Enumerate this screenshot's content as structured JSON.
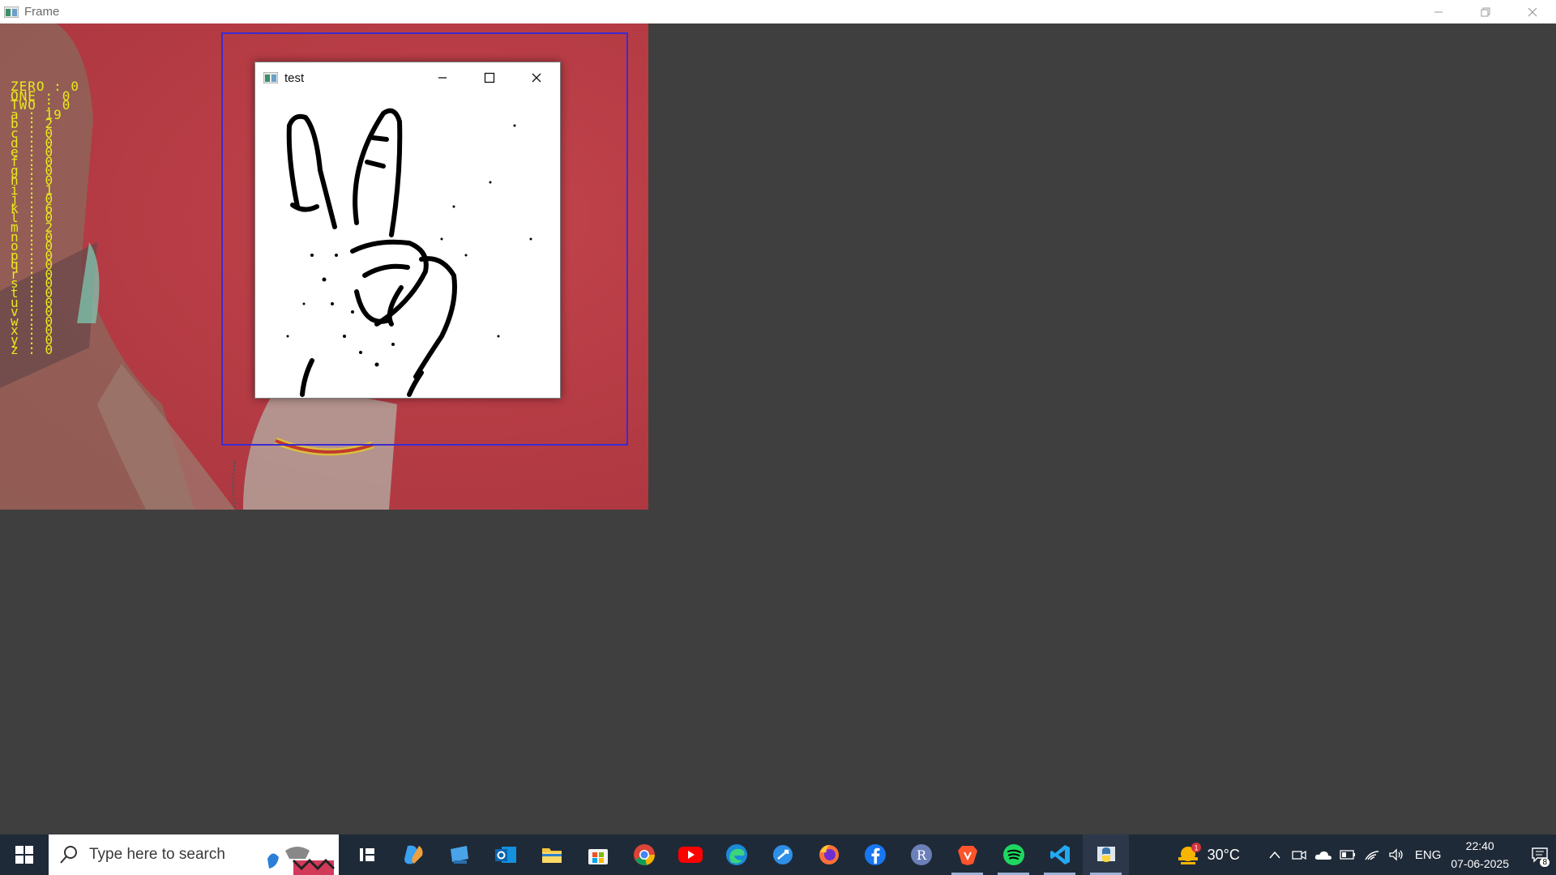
{
  "main_window": {
    "title": "Frame"
  },
  "counts": [
    "ZERO : 0",
    "ONE : 0",
    "TWO : 0",
    "a : 19",
    "b : 2",
    "c : 0",
    "d : 0",
    "e : 0",
    "f : 0",
    "g : 0",
    "h : 0",
    "i : 1",
    "j : 0",
    "k : 6",
    "l : 0",
    "m : 2",
    "n : 0",
    "o : 0",
    "p : 0",
    "q : 0",
    "r : 0",
    "s : 0",
    "t : 0",
    "u : 0",
    "v : 0",
    "w : 0",
    "x : 0",
    "y : 0",
    "z : 0"
  ],
  "test_window": {
    "title": "test"
  },
  "taskbar": {
    "search_placeholder": "Type here to search",
    "apps": [
      "task-view",
      "copilot",
      "desktop",
      "outlook",
      "file-explorer",
      "microsoft-store",
      "chrome",
      "youtube",
      "edge",
      "app",
      "firefox",
      "facebook",
      "r",
      "brave",
      "spotify",
      "vscode",
      "python"
    ],
    "weather": {
      "temp": "30°C",
      "badge": "1"
    },
    "language": "ENG",
    "time": "22:40",
    "date": "07-06-2025",
    "notification_count": "8"
  },
  "colors": {
    "count_text": "#e8e81e",
    "roi_box": "#3b2bd2",
    "taskbar": "#1f2a38"
  }
}
